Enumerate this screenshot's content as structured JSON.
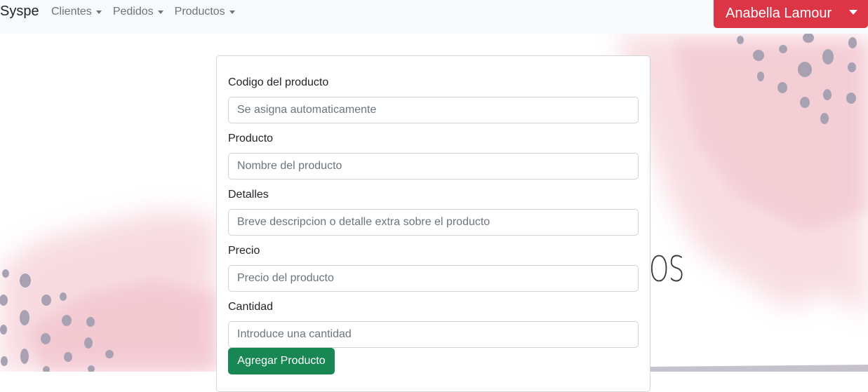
{
  "navbar": {
    "brand": "Syspe",
    "menu": [
      {
        "label": "Clientes"
      },
      {
        "label": "Pedidos"
      },
      {
        "label": "Productos"
      }
    ],
    "user": {
      "name": "Anabella Lamour"
    }
  },
  "background": {
    "partial_word": "OS"
  },
  "form": {
    "fields": [
      {
        "label": "Codigo del producto",
        "placeholder": "Se asigna automaticamente"
      },
      {
        "label": "Producto",
        "placeholder": "Nombre del producto"
      },
      {
        "label": "Detalles",
        "placeholder": "Breve descripcion o detalle extra sobre el producto"
      },
      {
        "label": "Precio",
        "placeholder": "Precio del producto"
      },
      {
        "label": "Cantidad",
        "placeholder": "Introduce una cantidad"
      }
    ],
    "submit_label": "Agregar Producto"
  },
  "colors": {
    "navbar_bg": "#f8f9fa",
    "user_button": "#dc3545",
    "submit_button": "#198754",
    "watercolor_pink": "#f6d3da",
    "dots": "#a7a1b2"
  }
}
